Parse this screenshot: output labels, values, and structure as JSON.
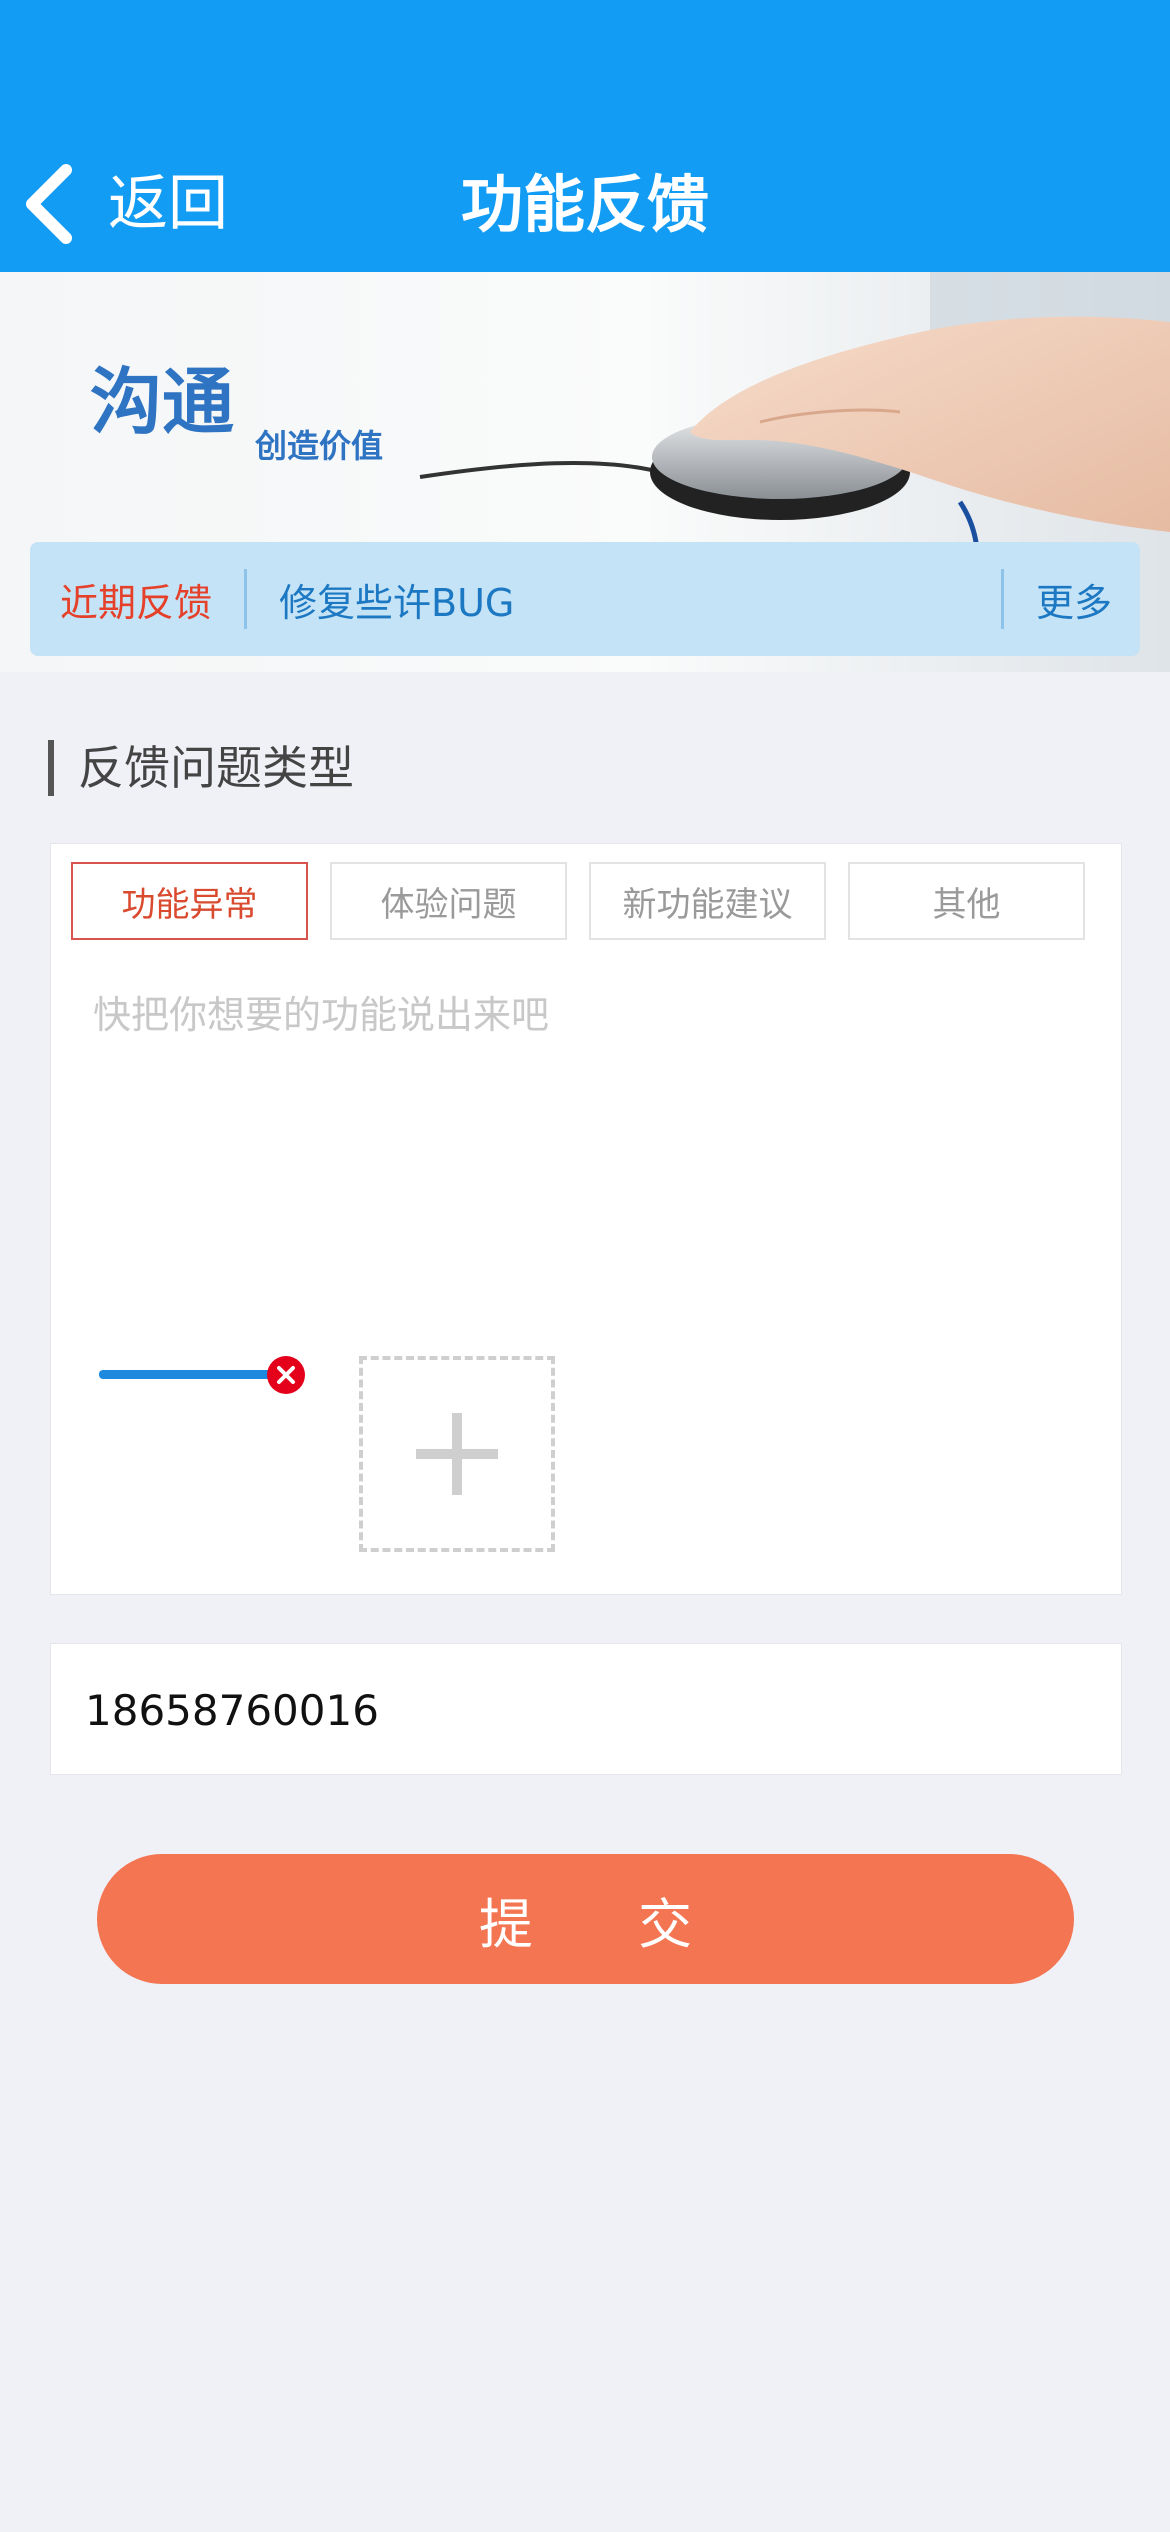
{
  "header": {
    "back_label": "返回",
    "title": "功能反馈",
    "background_color": "#139cf4"
  },
  "banner": {
    "headline": "沟通",
    "subline": "创造价值"
  },
  "news": {
    "tag": "近期反馈",
    "text": "修复些许BUG",
    "more": "更多"
  },
  "section": {
    "title": "反馈问题类型"
  },
  "tabs": [
    {
      "label": "功能异常",
      "active": true
    },
    {
      "label": "体验问题",
      "active": false
    },
    {
      "label": "新功能建议",
      "active": false
    },
    {
      "label": "其他",
      "active": false
    }
  ],
  "feedback": {
    "placeholder": "快把你想要的功能说出来吧",
    "value": ""
  },
  "attachments": {
    "remove_icon": "close-circle-icon",
    "add_icon": "plus-icon"
  },
  "contact": {
    "phone": "18658760016"
  },
  "submit": {
    "label": "提 交",
    "color": "#f37551"
  }
}
